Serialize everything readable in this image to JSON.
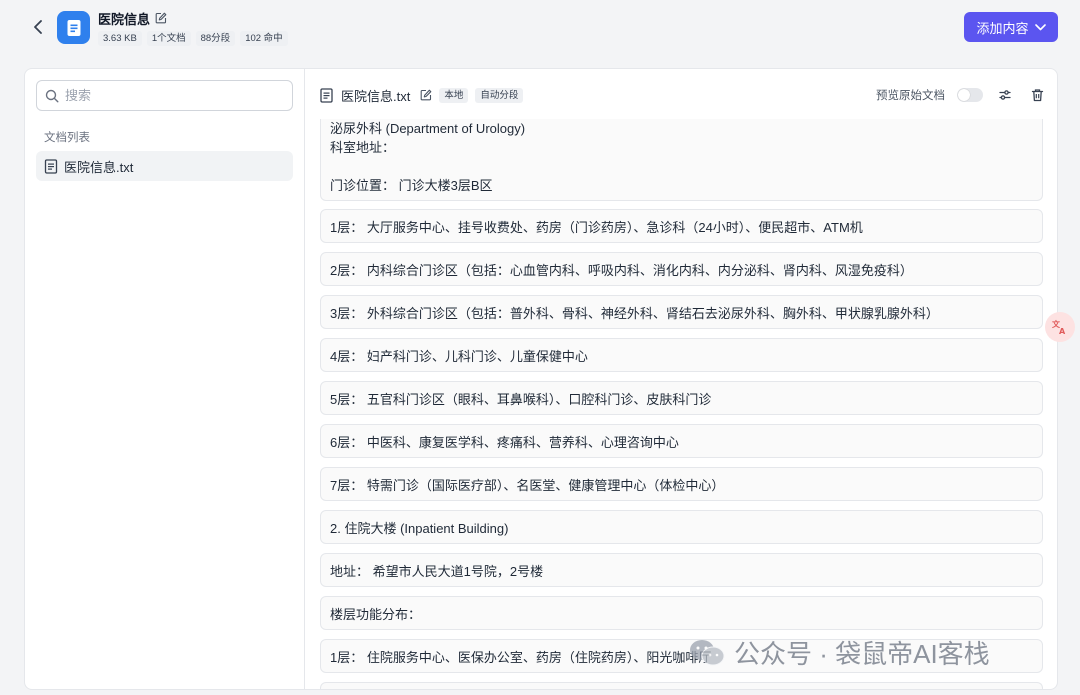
{
  "header": {
    "title": "医院信息",
    "meta": [
      "3.63 KB",
      "1个文档",
      "88分段",
      "102 命中"
    ],
    "add_button_label": "添加内容",
    "accent_color": "#5b55f0",
    "app_icon": "document-icon"
  },
  "sidebar": {
    "search_placeholder": "搜索",
    "section_label": "文档列表",
    "documents": [
      {
        "label": "医院信息.txt"
      }
    ]
  },
  "content": {
    "file_title": "医院信息.txt",
    "tags": [
      "本地",
      "自动分段"
    ],
    "preview_label": "预览原始文档",
    "first_segment_lines": [
      "泌尿外科 (Department of Urology)",
      "科室地址：",
      "",
      "门诊位置： 门诊大楼3层B区"
    ],
    "segments": [
      "1层： 大厅服务中心、挂号收费处、药房（门诊药房）、急诊科（24小时）、便民超市、ATM机",
      "2层： 内科综合门诊区（包括：心血管内科、呼吸内科、消化内科、内分泌科、肾内科、风湿免疫科）",
      "3层： 外科综合门诊区（包括：普外科、骨科、神经外科、肾结石去泌尿外科、胸外科、甲状腺乳腺外科）",
      "4层： 妇产科门诊、儿科门诊、儿童保健中心",
      "5层： 五官科门诊区（眼科、耳鼻喉科）、口腔科门诊、皮肤科门诊",
      "6层： 中医科、康复医学科、疼痛科、营养科、心理咨询中心",
      "7层： 特需门诊（国际医疗部）、名医堂、健康管理中心（体检中心）",
      "2. 住院大楼 (Inpatient Building)",
      "地址： 希望市人民大道1号院，2号楼",
      "楼层功能分布：",
      "1层： 住院服务中心、医保办公室、药房（住院药房）、阳光咖啡厅",
      ""
    ]
  },
  "watermark": {
    "text": "公众号 · 袋鼠帝AI客栈"
  }
}
